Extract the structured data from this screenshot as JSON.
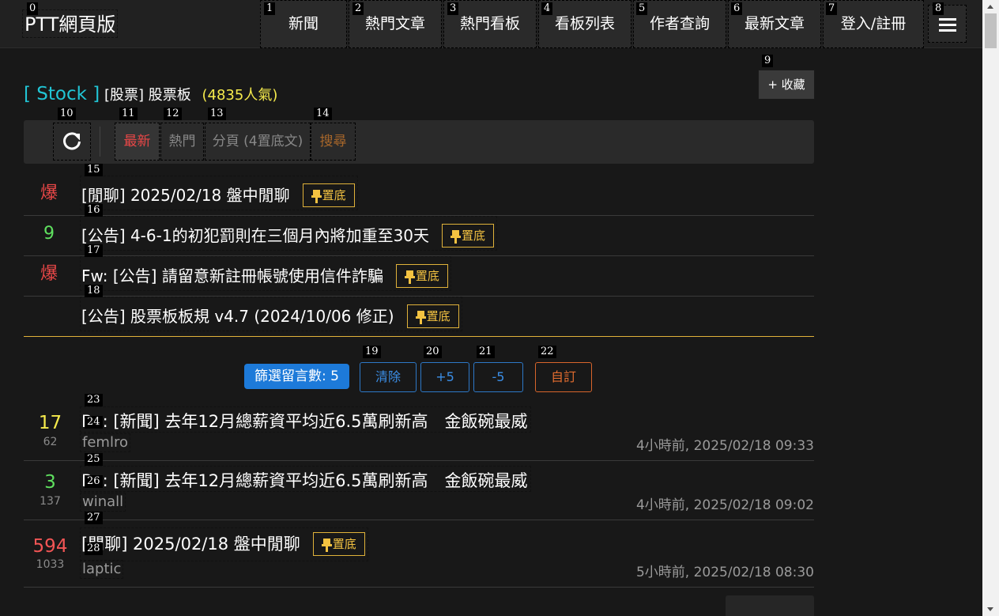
{
  "brand": "PTT網頁版",
  "nav": [
    {
      "label": "新聞"
    },
    {
      "label": "熱門文章"
    },
    {
      "label": "熱門看板"
    },
    {
      "label": "看板列表"
    },
    {
      "label": "作者查詢"
    },
    {
      "label": "最新文章"
    },
    {
      "label": "登入/註冊"
    }
  ],
  "board": {
    "name": "[ Stock ]",
    "class": "[股票] 股票板",
    "popularity": "(4835人氣)",
    "favorite_label": "+ 收藏"
  },
  "tabs": {
    "latest": "最新",
    "hot": "熱門",
    "paged": "分頁 (4置底文)",
    "search": "搜尋"
  },
  "pinned": [
    {
      "count": "爆",
      "count_color": "#e84747",
      "title": "[閒聊] 2025/02/18 盤中閒聊",
      "pin": "置底"
    },
    {
      "count": "9",
      "count_color": "#5fe05f",
      "title": "[公告] 4-6-1的初犯罰則在三個月內將加重至30天",
      "pin": "置底"
    },
    {
      "count": "爆",
      "count_color": "#e84747",
      "title": "Fw: [公告] 請留意新註冊帳號使用信件詐騙",
      "pin": "置底"
    },
    {
      "count": "",
      "count_color": "#e84747",
      "title": "[公告] 股票板板規 v4.7 (2024/10/06 修正)",
      "pin": "置底"
    }
  ],
  "filter": {
    "label": "篩選留言數: 5",
    "clear": "清除",
    "plus": "+5",
    "minus": "-5",
    "custom": "自訂"
  },
  "articles": [
    {
      "count": "17",
      "count_color": "#f5ea4c",
      "sub": "62",
      "title": "Re: [新聞] 去年12月總薪資平均近6.5萬刷新高　金飯碗最威",
      "author": "femlro",
      "time": "4小時前, 2025/02/18 09:33",
      "pin": ""
    },
    {
      "count": "3",
      "count_color": "#5fe05f",
      "sub": "137",
      "title": "Re: [新聞] 去年12月總薪資平均近6.5萬刷新高　金飯碗最威",
      "author": "winall",
      "time": "4小時前, 2025/02/18 09:02",
      "pin": ""
    },
    {
      "count": "594",
      "count_color": "#f25555",
      "sub": "1033",
      "title": "[閒聊] 2025/02/18 盤中閒聊",
      "author": "laptic",
      "time": "5小時前, 2025/02/18 08:30",
      "pin": "置底"
    }
  ]
}
